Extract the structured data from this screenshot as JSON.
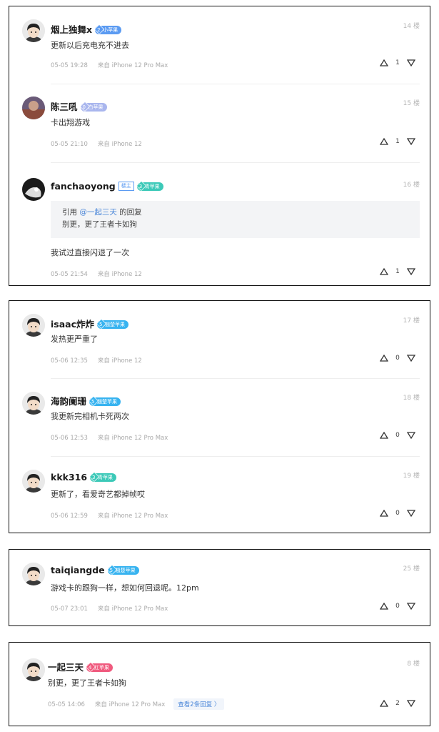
{
  "panels": [
    {
      "comments": [
        {
          "user": "烟上独舞x",
          "badge": "小苹果",
          "badge_level": "2",
          "floor": "14 楼",
          "text": "更新以后充电充不进去",
          "time": "05-05 19:28",
          "device": "来自 iPhone 12 Pro Max",
          "votes": "1"
        },
        {
          "user": "陈三吼",
          "badge": "白苹果",
          "badge_level": "0",
          "floor": "15 楼",
          "text": "卡出翔游戏",
          "time": "05-05 21:10",
          "device": "来自 iPhone 12",
          "votes": "1"
        },
        {
          "user": "fanchaoyong",
          "op_tag": "楼主",
          "badge": "青苹果",
          "badge_level": "3",
          "floor": "16 楼",
          "quote_prefix": "引用 ",
          "quote_mention": "@一起三天",
          "quote_suffix": " 的回复",
          "quote_text": "别更，更了王者卡如狗",
          "text": "我试过直接闪退了一次",
          "time": "05-05 21:54",
          "device": "来自 iPhone 12",
          "votes": "1"
        }
      ]
    },
    {
      "comments": [
        {
          "user": "isaac炸炸",
          "badge": "翘楚苹果",
          "badge_level": "5",
          "floor": "17 楼",
          "text": "发热更严重了",
          "time": "05-06 12:35",
          "device": "来自 iPhone 12",
          "votes": "0"
        },
        {
          "user": "海韵阑珊",
          "badge": "翘楚苹果",
          "badge_level": "5",
          "floor": "18 楼",
          "text": "我更新完相机卡死两次",
          "time": "05-06 12:53",
          "device": "来自 iPhone 12 Pro Max",
          "votes": "0"
        },
        {
          "user": "kkk316",
          "badge": "青苹果",
          "badge_level": "3",
          "floor": "19 楼",
          "text": "更新了，看爱奇艺都掉帧哎",
          "time": "05-06 12:59",
          "device": "来自 iPhone 12 Pro Max",
          "votes": "0"
        }
      ]
    },
    {
      "comments": [
        {
          "user": "taiqiangde",
          "badge": "翘楚苹果",
          "badge_level": "5",
          "floor": "25 楼",
          "text": "游戏卡的跟狗一样，想如何回退呢。12pm",
          "time": "05-07 23:01",
          "device": "来自 iPhone 12 Pro Max",
          "votes": "0"
        }
      ]
    },
    {
      "comments": [
        {
          "user": "一起三天",
          "badge": "红苹果",
          "badge_level": "4",
          "floor": "8 楼",
          "text": "别更，更了王者卡如狗",
          "time": "05-05 14:06",
          "device": "来自 iPhone 12 Pro Max",
          "reply_link": "查看2条回复 〉",
          "votes": "2"
        }
      ]
    }
  ],
  "colors": {
    "badge_blue": "#5b9bf2",
    "badge_lavender": "#a9b6ee",
    "badge_teal": "#3cc9b8",
    "badge_sky": "#37b3f0",
    "badge_pink": "#f05a7e",
    "link": "#4a86d8"
  }
}
